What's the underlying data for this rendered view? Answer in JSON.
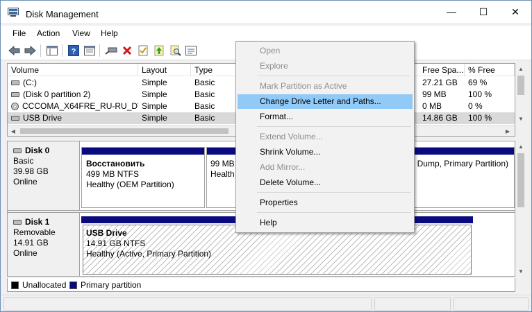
{
  "window": {
    "title": "Disk Management",
    "minimize": "—",
    "maximize": "☐",
    "close": "✕"
  },
  "menubar": [
    "File",
    "Action",
    "View",
    "Help"
  ],
  "volume_table": {
    "columns": [
      "Volume",
      "Layout",
      "Type",
      "Free Spa...",
      "% Free"
    ],
    "rows": [
      {
        "volume": "(C:)",
        "layout": "Simple",
        "type": "Basic",
        "free": "27.21 GB",
        "pct": "69 %",
        "icon": "drive-icon"
      },
      {
        "volume": "(Disk 0 partition 2)",
        "layout": "Simple",
        "type": "Basic",
        "free": "99 MB",
        "pct": "100 %",
        "icon": "drive-icon"
      },
      {
        "volume": "CCCOMA_X64FRE_RU-RU_DV...",
        "layout": "Simple",
        "type": "Basic",
        "free": "0 MB",
        "pct": "0 %",
        "icon": "cd-drive-icon"
      },
      {
        "volume": "USB Drive",
        "layout": "Simple",
        "type": "Basic",
        "free": "14.86 GB",
        "pct": "100 %",
        "icon": "drive-icon"
      }
    ]
  },
  "disks": [
    {
      "name": "Disk 0",
      "kind": "Basic",
      "size": "39.98 GB",
      "status": "Online",
      "partitions": [
        {
          "title": "Восстановить",
          "size": "499 MB NTFS",
          "health": "Healthy (OEM Partition)"
        },
        {
          "title": "",
          "size": "99 MB",
          "health": "Health"
        },
        {
          "title": "",
          "size": "",
          "health": "n Dump, Primary Partition)"
        }
      ]
    },
    {
      "name": "Disk 1",
      "kind": "Removable",
      "size": "14.91 GB",
      "status": "Online",
      "partitions": [
        {
          "title": "USB Drive",
          "size": "14.91 GB NTFS",
          "health": "Healthy (Active, Primary Partition)"
        }
      ]
    }
  ],
  "legend": {
    "unallocated": "Unallocated",
    "primary": "Primary partition",
    "unallocated_color": "#000000",
    "primary_color": "#0a0a80"
  },
  "context_menu": {
    "open": "Open",
    "explore": "Explore",
    "mark_active": "Mark Partition as Active",
    "change_letter": "Change Drive Letter and Paths...",
    "format": "Format...",
    "extend": "Extend Volume...",
    "shrink": "Shrink Volume...",
    "add_mirror": "Add Mirror...",
    "delete": "Delete Volume...",
    "properties": "Properties",
    "help": "Help"
  },
  "colors": {
    "accent_hover": "#91c9f7",
    "partition_bar": "#0a0a80"
  }
}
